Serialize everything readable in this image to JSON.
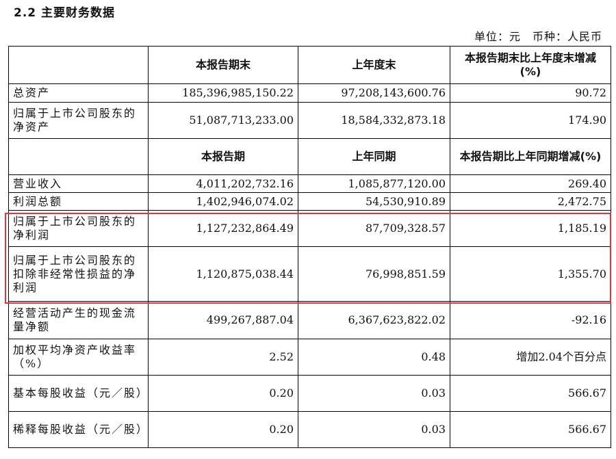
{
  "title": "2.2 主要财务数据",
  "unit": "单位：元　币种：人民币",
  "table": {
    "header1": [
      "",
      "本报告期末",
      "上年度末",
      "本报告期末比上年度末增减(%)"
    ],
    "rows1": [
      {
        "label": "总资产",
        "c1": "185,396,985,150.22",
        "c2": "97,208,143,600.76",
        "c3": "90.72"
      },
      {
        "label": "归属于上市公司股东的净资产",
        "c1": "51,087,713,233.00",
        "c2": "18,584,332,873.18",
        "c3": "174.90"
      }
    ],
    "header2": [
      "",
      "本报告期",
      "上年同期",
      "本报告期比上年同期增减(%)"
    ],
    "rows2": [
      {
        "label": "营业收入",
        "c1": "4,011,202,732.16",
        "c2": "1,085,877,120.00",
        "c3": "269.40"
      },
      {
        "label": "利润总额",
        "c1": "1,402,946,074.02",
        "c2": "54,530,910.89",
        "c3": "2,472.75"
      },
      {
        "label": "归属于上市公司股东的净利润",
        "c1": "1,127,232,864.49",
        "c2": "87,709,328.57",
        "c3": "1,185.19"
      },
      {
        "label": "归属于上市公司股东的扣除非经常性损益的净利润",
        "c1": "1,120,875,038.44",
        "c2": "76,998,851.59",
        "c3": "1,355.70"
      },
      {
        "label": "经营活动产生的现金流量净额",
        "c1": "499,267,887.04",
        "c2": "6,367,623,822.02",
        "c3": "-92.16"
      },
      {
        "label": "加权平均净资产收益率（%）",
        "c1": "2.52",
        "c2": "0.48",
        "c3": "增加2.04个百分点"
      },
      {
        "label": "基本每股收益（元／股）",
        "c1": "0.20",
        "c2": "0.03",
        "c3": "566.67"
      },
      {
        "label": "稀释每股收益（元／股）",
        "c1": "0.20",
        "c2": "0.03",
        "c3": "566.67"
      }
    ]
  },
  "highlight_color": "#e0353b"
}
